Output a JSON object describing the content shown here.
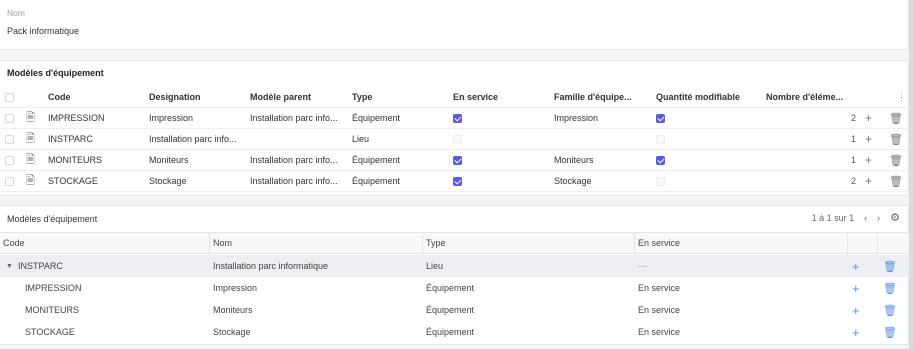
{
  "nom": {
    "label": "Nom",
    "value": "Pack informatique"
  },
  "equipment": {
    "title": "Modèles d'équipement",
    "headers": {
      "code": "Code",
      "designation": "Designation",
      "parent": "Modèle parent",
      "type": "Type",
      "service": "En service",
      "famille": "Famille d'équipe...",
      "qty": "Quantité modifiable",
      "count": "Nombre d'éléme..."
    },
    "rows": [
      {
        "code": "IMPRESSION",
        "designation": "Impression",
        "parent": "Installation parc info...",
        "type": "Équipement",
        "service": true,
        "famille": "Impression",
        "qty": true,
        "count": "2"
      },
      {
        "code": "INSTPARC",
        "designation": "Installation parc info...",
        "parent": "",
        "type": "Lieu",
        "service": false,
        "famille": "",
        "qty": false,
        "count": "1"
      },
      {
        "code": "MONITEURS",
        "designation": "Moniteurs",
        "parent": "Installation parc info...",
        "type": "Équipement",
        "service": true,
        "famille": "Moniteurs",
        "qty": true,
        "count": "1"
      },
      {
        "code": "STOCKAGE",
        "designation": "Stockage",
        "parent": "Installation parc info...",
        "type": "Équipement",
        "service": true,
        "famille": "Stockage",
        "qty": false,
        "count": "2"
      }
    ]
  },
  "tree": {
    "title": "Modèles d'équipement",
    "pager": "1 à 1 sur 1",
    "headers": {
      "code": "Code",
      "nom": "Nom",
      "type": "Type",
      "service": "En service"
    },
    "rows": [
      {
        "code": "INSTPARC",
        "nom": "Installation parc informatique",
        "type": "Lieu",
        "service": "---"
      },
      {
        "code": "IMPRESSION",
        "nom": "Impression",
        "type": "Équipement",
        "service": "En service"
      },
      {
        "code": "MONITEURS",
        "nom": "Moniteurs",
        "type": "Équipement",
        "service": "En service"
      },
      {
        "code": "STOCKAGE",
        "nom": "Stockage",
        "type": "Équipement",
        "service": "En service"
      }
    ]
  },
  "colors": {
    "accent": "#5b5bd6",
    "link": "#5b8fe0"
  }
}
